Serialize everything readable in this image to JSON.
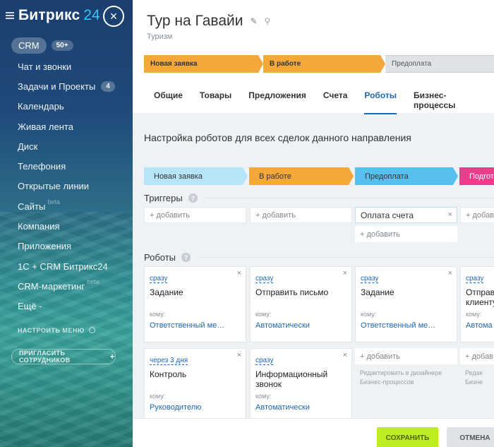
{
  "sidebar": {
    "brand": "Битрикс",
    "brand_num": "24",
    "crm": {
      "label": "CRM",
      "count": "50+"
    },
    "items": [
      {
        "label": "Чат и звонки"
      },
      {
        "label": "Задачи и Проекты",
        "badge": "4"
      },
      {
        "label": "Календарь"
      },
      {
        "label": "Живая лента"
      },
      {
        "label": "Диск"
      },
      {
        "label": "Телефония"
      },
      {
        "label": "Открытые линии"
      },
      {
        "label": "Сайты",
        "sup": "beta"
      },
      {
        "label": "Компания"
      },
      {
        "label": "Приложения"
      },
      {
        "label": "1С + CRM Битрикс24"
      },
      {
        "label": "CRM-маркетинг",
        "sup": "beta"
      },
      {
        "label": "Ещё -"
      }
    ],
    "settings": "НАСТРОИТЬ МЕНЮ",
    "invite": "ПРИГЛАСИТЬ СОТРУДНИКОВ",
    "invite_plus": "+"
  },
  "close_icon": "×",
  "deal": {
    "title": "Тур на Гавайи",
    "subtitle": "Туризм",
    "pencil": "✎",
    "link": "⚲"
  },
  "top_stages": [
    "Новая заявка",
    "В работе",
    "Предоплата"
  ],
  "tabs": [
    "Общие",
    "Товары",
    "Предложения",
    "Счета",
    "Роботы",
    "Бизнес-процессы"
  ],
  "active_tab": "Роботы",
  "section_title": "Настройка роботов для всех сделок данного направления",
  "robot_stages": [
    "Новая заявка",
    "В работе",
    "Предоплата",
    "Подгот"
  ],
  "triggers": {
    "label": "Триггеры",
    "help": "?",
    "add": "+ добавить",
    "trigger_name": "Оплата счета",
    "x": "×",
    "add_short": "+ добав"
  },
  "robots": {
    "label": "Роботы",
    "help": "?",
    "to_label": "кому:",
    "cards": [
      {
        "when": "сразу",
        "name": "Задание",
        "to": "кому:",
        "resp": "Ответственный ме…"
      },
      {
        "when": "сразу",
        "name": "Отправить письмо",
        "to": "кому:",
        "resp": "Автоматически"
      },
      {
        "when": "сразу",
        "name": "Задание",
        "to": "кому:",
        "resp": "Ответственный ме…"
      },
      {
        "when": "сразу",
        "name": "Отправ клиенту",
        "to": "кому:",
        "resp": "Автома"
      },
      {
        "when": "через 3 дня",
        "name": "Контроль",
        "to": "кому:",
        "resp": "Руководителю"
      },
      {
        "when": "сразу",
        "name": "Информационный звонок",
        "to": "кому:",
        "resp": "Автоматически"
      }
    ],
    "add": "+ добавить",
    "add_short": "+ добав",
    "designer_note": "Редактировать в дизайнере Бизнес-процессов",
    "designer_note_short": "Редак Бизне"
  },
  "footer": {
    "save": "СОХРАНИТЬ",
    "cancel": "ОТМЕНА"
  }
}
